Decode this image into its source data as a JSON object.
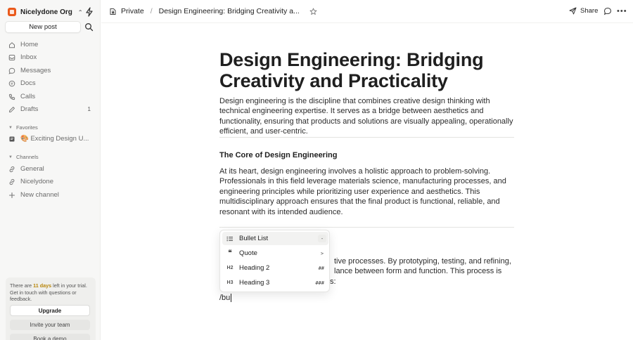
{
  "sidebar": {
    "org_name": "Nicelydone Org",
    "new_post": "New post",
    "nav": [
      {
        "label": "Home",
        "count": ""
      },
      {
        "label": "Inbox",
        "count": ""
      },
      {
        "label": "Messages",
        "count": ""
      },
      {
        "label": "Docs",
        "count": ""
      },
      {
        "label": "Calls",
        "count": ""
      },
      {
        "label": "Drafts",
        "count": "1"
      }
    ],
    "favorites_label": "Favorites",
    "favorites": [
      {
        "label": "🎨 Exciting Design U..."
      }
    ],
    "channels_label": "Channels",
    "channels": [
      {
        "label": "General"
      },
      {
        "label": "Nicelydone"
      }
    ],
    "new_channel": "New channel",
    "trial": {
      "text_before": "There are ",
      "days": "11 days",
      "text_after": " left in your trial. Get in touch with questions or feedback.",
      "upgrade": "Upgrade",
      "invite": "Invite your team",
      "demo": "Book a demo"
    }
  },
  "topbar": {
    "privacy": "Private",
    "separator": "/",
    "doc_title": "Design Engineering: Bridging Creativity a...",
    "share": "Share"
  },
  "document": {
    "title": "Design Engineering: Bridging Creativity and Practicality",
    "intro": "Design engineering is the discipline that combines creative design thinking with technical engineering expertise. It serves as a bridge between aesthetics and functionality, ensuring that products and solutions are visually appealing, operationally efficient, and user-centric.",
    "section1_heading": "The Core of Design Engineering",
    "section1_body": "At its heart, design engineering involves a holistic approach to problem-solving. Professionals in this field leverage materials science, manufacturing processes, and engineering principles while prioritizing user experience and aesthetics. This multidisciplinary approach ensures that the final product is functional, reliable, and resonant with its intended audience.",
    "hidden_line1": "tive processes. By prototyping, testing, and refining,",
    "hidden_line2": "lance between form and function. This process is",
    "hidden_line3": "s:",
    "typed": "/bu"
  },
  "slash_menu": {
    "items": [
      {
        "label": "Bullet List",
        "icon": "list-icon",
        "shortcut": "-"
      },
      {
        "label": "Quote",
        "icon": "quote-icon",
        "shortcut": ">"
      },
      {
        "label": "Heading 2",
        "icon": "H2",
        "shortcut": "##"
      },
      {
        "label": "Heading 3",
        "icon": "H3",
        "shortcut": "###"
      }
    ]
  },
  "colors": {
    "accent_org": "#ea5a1c",
    "trial_highlight": "#b8860b",
    "sidebar_bg": "#f7f7f6"
  }
}
